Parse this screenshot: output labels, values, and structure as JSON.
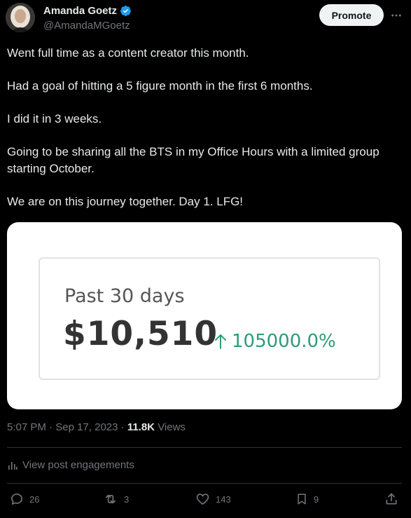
{
  "user": {
    "display_name": "Amanda Goetz",
    "handle": "@AmandaMGoetz",
    "avatar_icon": "avatar-photo",
    "verified_color": "#1d9bf0"
  },
  "header": {
    "promote_label": "Promote",
    "more_icon": "more-icon"
  },
  "tweet": {
    "paragraphs": [
      "Went full time as a content creator this month.",
      "Had a goal of hitting a 5 figure month in the first 6 months.",
      "I did it in 3 weeks.",
      "Going to be sharing all the BTS in my Office Hours with a limited group starting October.",
      "We are on this journey together. Day 1. LFG!"
    ]
  },
  "media": {
    "label": "Past 30 days",
    "value": "$10,510",
    "change": "105000.0%",
    "change_color": "#2e9b78"
  },
  "meta": {
    "time": "5:07 PM",
    "separator": "·",
    "date": "Sep 17, 2023",
    "views_count": "11.8K",
    "views_label": "Views"
  },
  "engagements_label": "View post engagements",
  "actions": {
    "replies": "26",
    "reposts": "3",
    "likes": "143",
    "bookmarks": "9"
  },
  "colors": {
    "background": "#000000",
    "text": "#e7e9ea",
    "muted": "#71767b",
    "divider": "#2f3336"
  }
}
